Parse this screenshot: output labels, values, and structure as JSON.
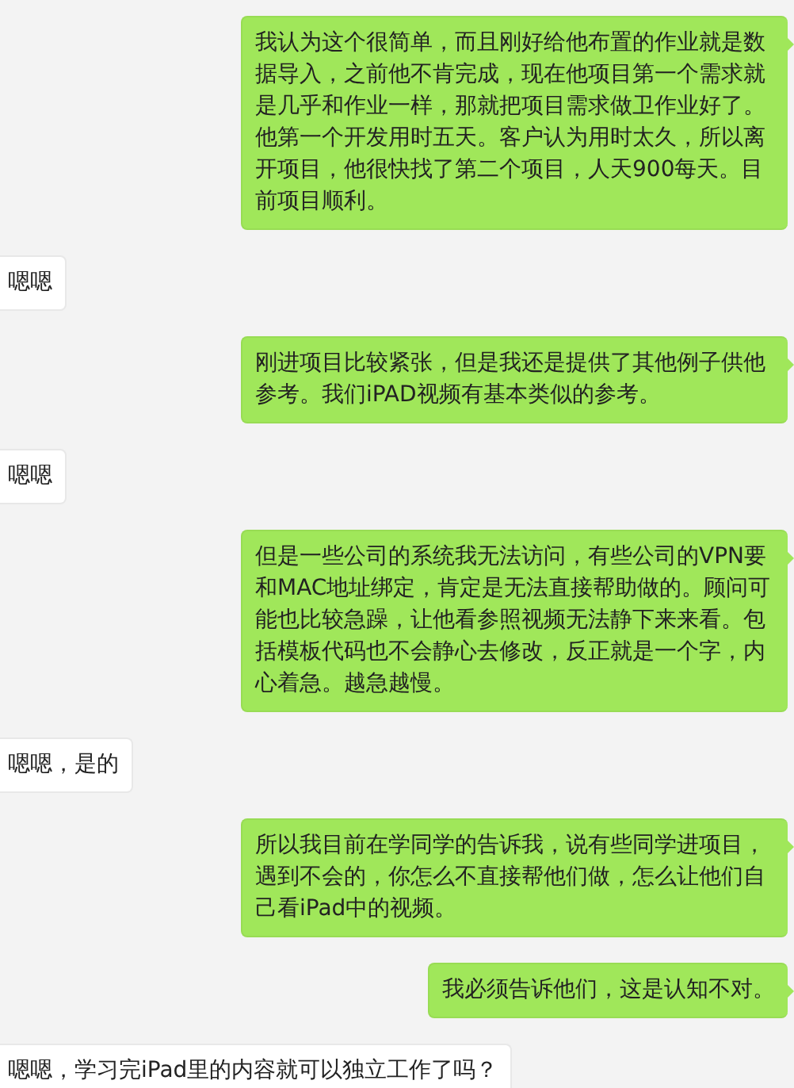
{
  "messages": [
    {
      "kind": "sent",
      "text": "我认为这个很简单，而且刚好给他布置的作业就是数据导入，之前他不肯完成，现在他项目第一个需求就是几乎和作业一样，那就把项目需求做卫作业好了。他第一个开发用时五天。客户认为用时太久，所以离开项目，他很快找了第二个项目，人天900每天。目前项目顺利。"
    },
    {
      "kind": "received",
      "text": "嗯嗯"
    },
    {
      "kind": "sent",
      "text": "刚进项目比较紧张，但是我还是提供了其他例子供他参考。我们iPAD视频有基本类似的参考。"
    },
    {
      "kind": "received",
      "text": "嗯嗯"
    },
    {
      "kind": "sent",
      "text": "但是一些公司的系统我无法访问，有些公司的VPN要和MAC地址绑定，肯定是无法直接帮助做的。顾问可能也比较急躁，让他看参照视频无法静下来来看。包括模板代码也不会静心去修改，反正就是一个字，内心着急。越急越慢。"
    },
    {
      "kind": "received",
      "text": "嗯嗯，是的"
    },
    {
      "kind": "sent",
      "text": "所以我目前在学同学的告诉我，说有些同学进项目，遇到不会的，你怎么不直接帮他们做，怎么让他们自己看iPad中的视频。"
    },
    {
      "kind": "sent",
      "text": "我必须告诉他们，这是认知不对。"
    },
    {
      "kind": "received",
      "text": "嗯嗯，学习完iPad里的内容就可以独立工作了吗？"
    }
  ]
}
